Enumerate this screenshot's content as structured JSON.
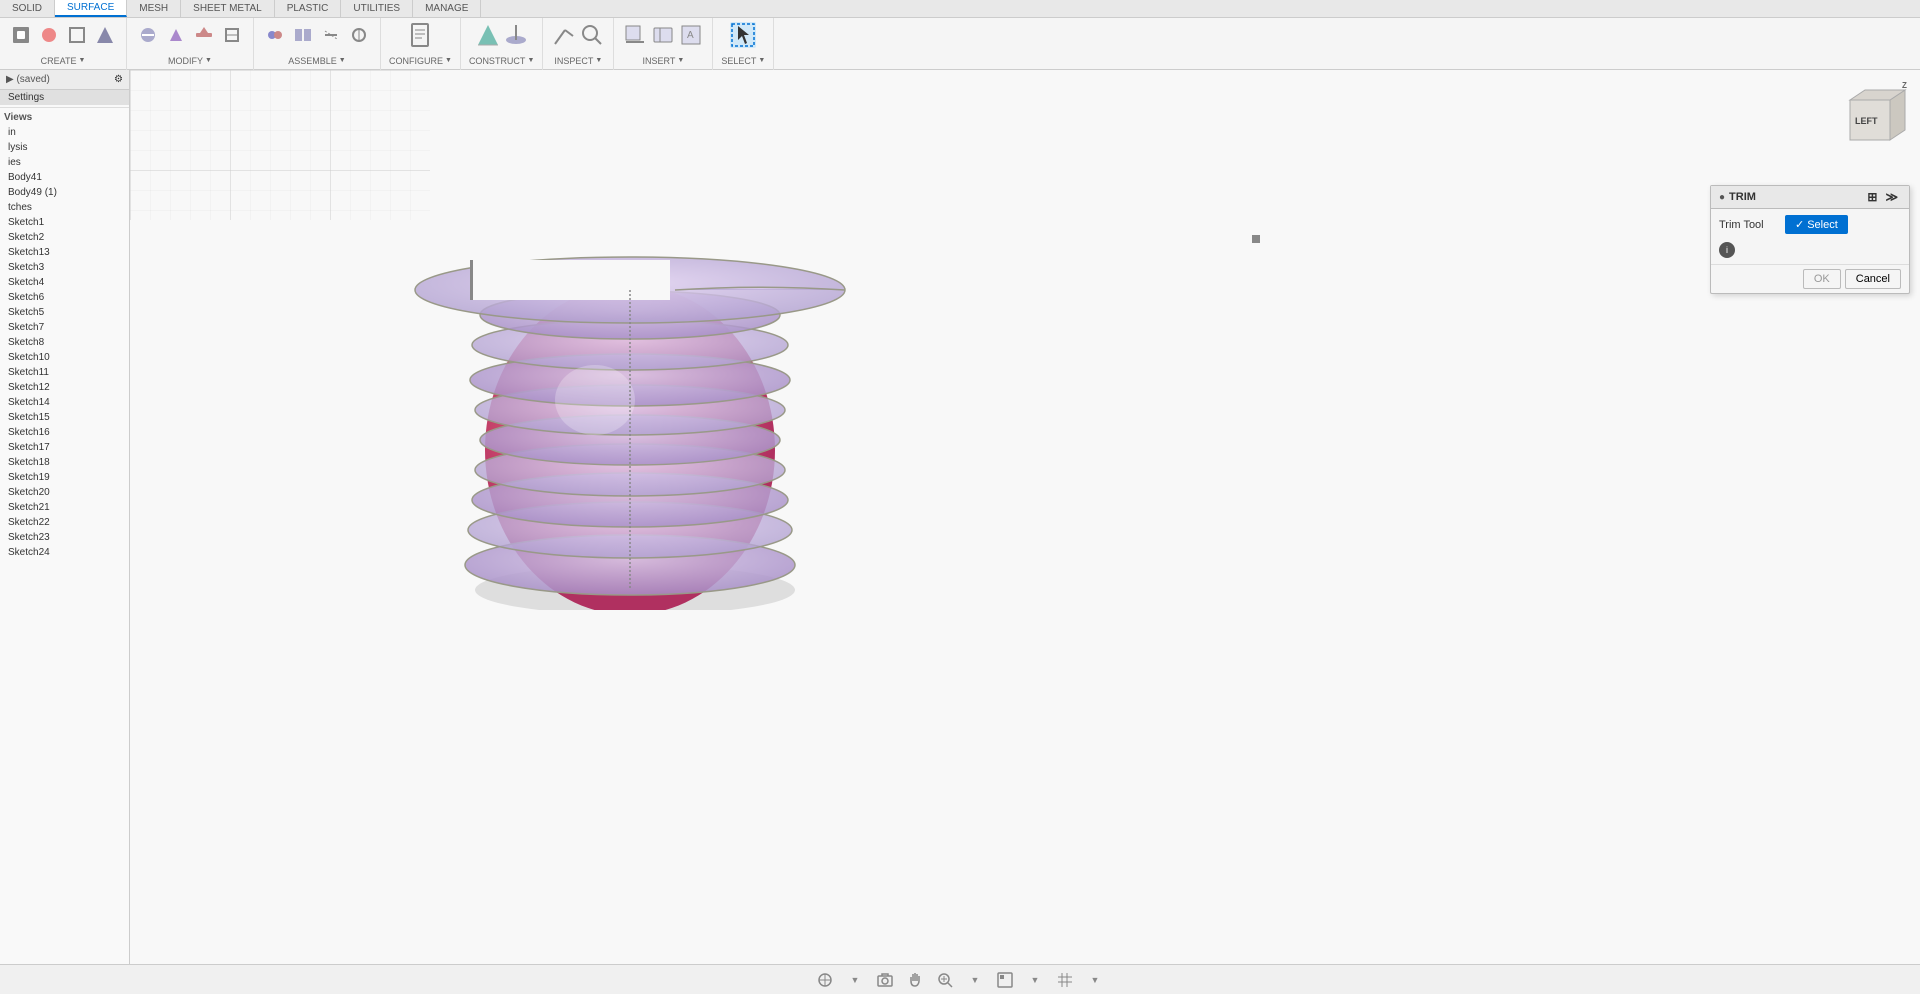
{
  "tabs": [
    {
      "label": "SOLID",
      "active": false
    },
    {
      "label": "SURFACE",
      "active": true
    },
    {
      "label": "MESH",
      "active": false
    },
    {
      "label": "SHEET METAL",
      "active": false
    },
    {
      "label": "PLASTIC",
      "active": false
    },
    {
      "label": "UTILITIES",
      "active": false
    },
    {
      "label": "MANAGE",
      "active": false
    }
  ],
  "toolbar_groups": [
    {
      "label": "CREATE",
      "has_dropdown": true,
      "icons": [
        "⬛",
        "🔲",
        "⬜",
        "📐"
      ]
    },
    {
      "label": "MODIFY",
      "has_dropdown": true,
      "icons": [
        "✂",
        "📋",
        "🔧",
        "⚙"
      ]
    },
    {
      "label": "ASSEMBLE",
      "has_dropdown": true,
      "icons": [
        "🔗",
        "📊",
        "📏",
        "🔩"
      ]
    },
    {
      "label": "CONFIGURE",
      "has_dropdown": true,
      "icons": [
        "⚙"
      ]
    },
    {
      "label": "CONSTRUCT",
      "has_dropdown": true,
      "icons": [
        "📐",
        "🔺"
      ]
    },
    {
      "label": "INSPECT",
      "has_dropdown": true,
      "icons": [
        "🔍",
        "📏"
      ]
    },
    {
      "label": "INSERT",
      "has_dropdown": true,
      "icons": [
        "📷",
        "📦"
      ]
    },
    {
      "label": "SELECT",
      "has_dropdown": true,
      "icons": [
        "↖"
      ]
    }
  ],
  "left_panel": {
    "items": [
      {
        "label": "Views",
        "type": "section"
      },
      {
        "label": "in",
        "type": "item"
      },
      {
        "label": "lysis",
        "type": "item"
      },
      {
        "label": "ies",
        "type": "item"
      },
      {
        "label": "Body41",
        "type": "item"
      },
      {
        "label": "Body49 (1)",
        "type": "item"
      },
      {
        "label": "tches",
        "type": "item"
      },
      {
        "label": "Sketch1",
        "type": "item"
      },
      {
        "label": "Sketch2",
        "type": "item"
      },
      {
        "label": "Sketch13",
        "type": "item"
      },
      {
        "label": "Sketch3",
        "type": "item"
      },
      {
        "label": "Sketch4",
        "type": "item"
      },
      {
        "label": "Sketch6",
        "type": "item"
      },
      {
        "label": "Sketch5",
        "type": "item"
      },
      {
        "label": "Sketch7",
        "type": "item"
      },
      {
        "label": "Sketch8",
        "type": "item"
      },
      {
        "label": "Sketch10",
        "type": "item"
      },
      {
        "label": "Sketch11",
        "type": "item"
      },
      {
        "label": "Sketch12",
        "type": "item"
      },
      {
        "label": "Sketch14",
        "type": "item"
      },
      {
        "label": "Sketch15",
        "type": "item"
      },
      {
        "label": "Sketch16",
        "type": "item"
      },
      {
        "label": "Sketch17",
        "type": "item"
      },
      {
        "label": "Sketch18",
        "type": "item"
      },
      {
        "label": "Sketch19",
        "type": "item"
      },
      {
        "label": "Sketch20",
        "type": "item"
      },
      {
        "label": "Sketch21",
        "type": "item"
      },
      {
        "label": "Sketch22",
        "type": "item"
      },
      {
        "label": "Sketch23",
        "type": "item"
      },
      {
        "label": "Sketch24",
        "type": "item"
      }
    ]
  },
  "trim_panel": {
    "title": "TRIM",
    "trim_tool_label": "Trim Tool",
    "select_button": "Select",
    "ok_button": "OK",
    "cancel_button": "Cancel"
  },
  "orient_cube": {
    "label": "LEFT"
  },
  "bottom_icons": [
    "⊕",
    "📷",
    "✋",
    "🔍",
    "🖥",
    "⬛",
    "📊"
  ],
  "construct_label": "CONSTRUCT -"
}
